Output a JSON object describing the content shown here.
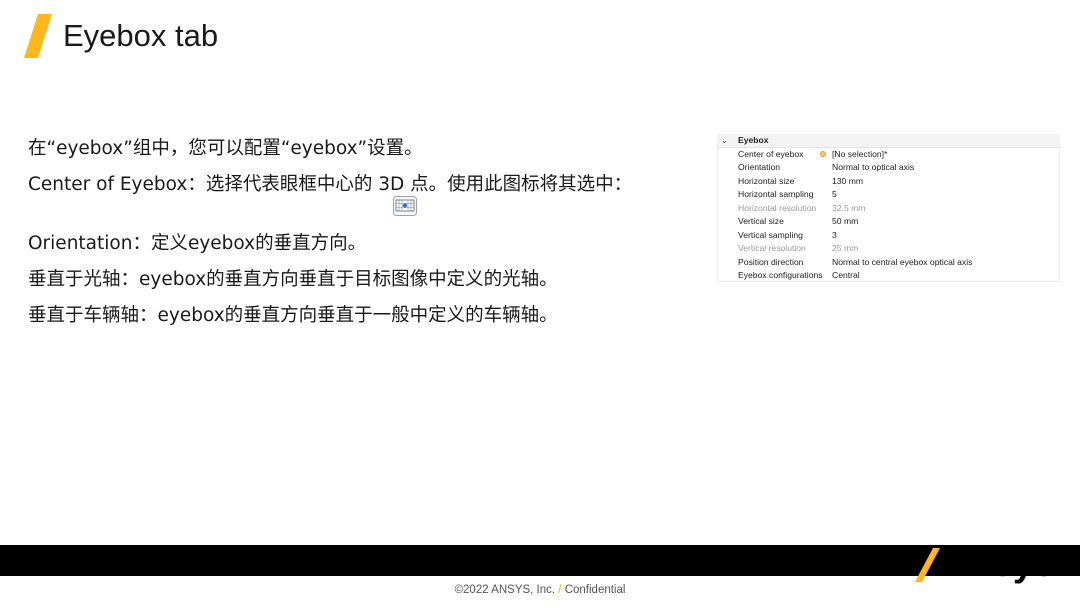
{
  "slide": {
    "title": "Eyebox tab",
    "accent_color": "#ffb71b"
  },
  "content": {
    "p1": "在“eyebox”组中，您可以配置“eyebox”设置。",
    "p2": "Center of Eyebox：选择代表眼框中心的 3D 点。使用此图标将其选中：",
    "p3": "Orientation：定义eyebox的垂直方向。",
    "p4": "垂直于光轴：eyebox的垂直方向垂直于目标图像中定义的光轴。",
    "p5": "垂直于车辆轴：eyebox的垂直方向垂直于一般中定义的车辆轴。",
    "inline_icon": "point-selection-icon"
  },
  "properties": {
    "group_label": "Eyebox",
    "rows": [
      {
        "key": "Center of eyebox",
        "value": "[No selection]*"
      },
      {
        "key": "Orientation",
        "value": "Normal to optical axis"
      },
      {
        "key": "Horizontal size",
        "value": "130 mm"
      },
      {
        "key": "Horizontal sampling",
        "value": "5"
      },
      {
        "key": "Horizontal resolution",
        "value": "32.5 mm"
      },
      {
        "key": "Vertical size",
        "value": "50 mm"
      },
      {
        "key": "Vertical sampling",
        "value": "3"
      },
      {
        "key": "Vertical resolution",
        "value": "25 mm"
      },
      {
        "key": "Position direction",
        "value": "Normal to central eyebox optical axis"
      },
      {
        "key": "Eyebox configurations",
        "value": "Central"
      }
    ]
  },
  "footer": {
    "brand": "Ansys",
    "copyright_left": "©2022 ANSYS, Inc.",
    "copyright_sep": "/",
    "copyright_right": "Confidential"
  }
}
